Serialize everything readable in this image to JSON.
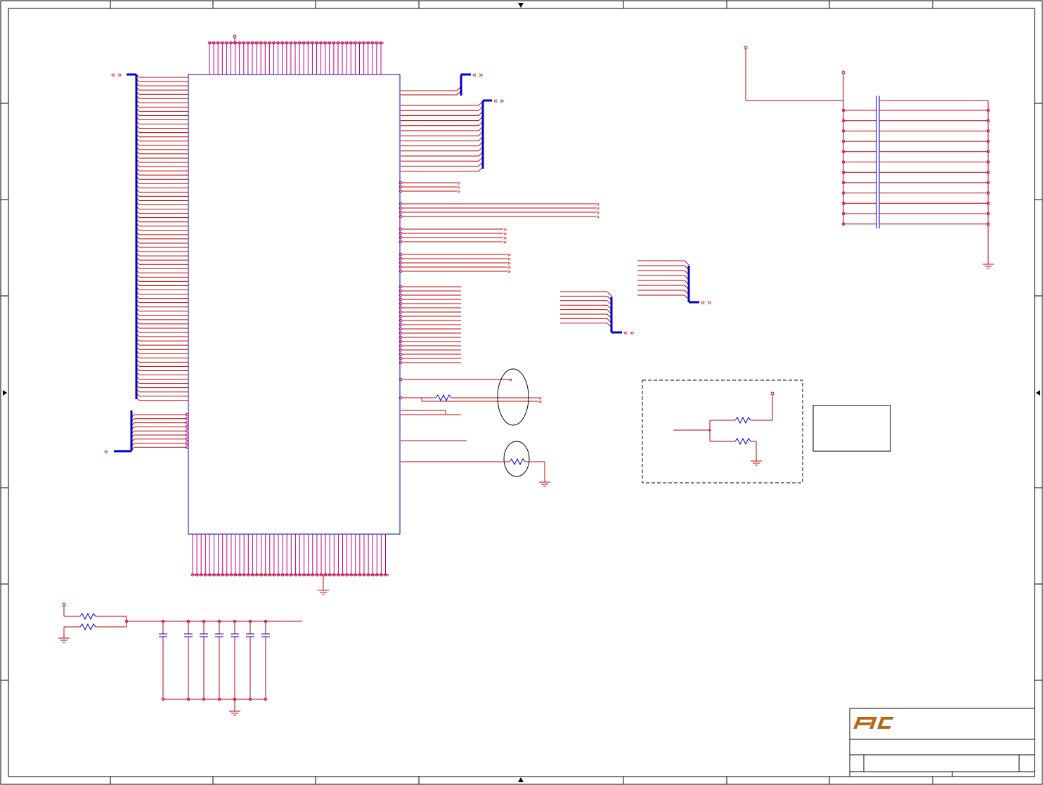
{
  "sheet": {
    "background": "#ffffff",
    "frame_color": "#000000",
    "wire_color": "#c00000",
    "bus_color": "#0000cc",
    "body_color": "#0000cc",
    "pin_color": "#c0007a",
    "logo_color": "#b8661a"
  },
  "title_block": {
    "logo_icon": "company-logo-icon"
  }
}
